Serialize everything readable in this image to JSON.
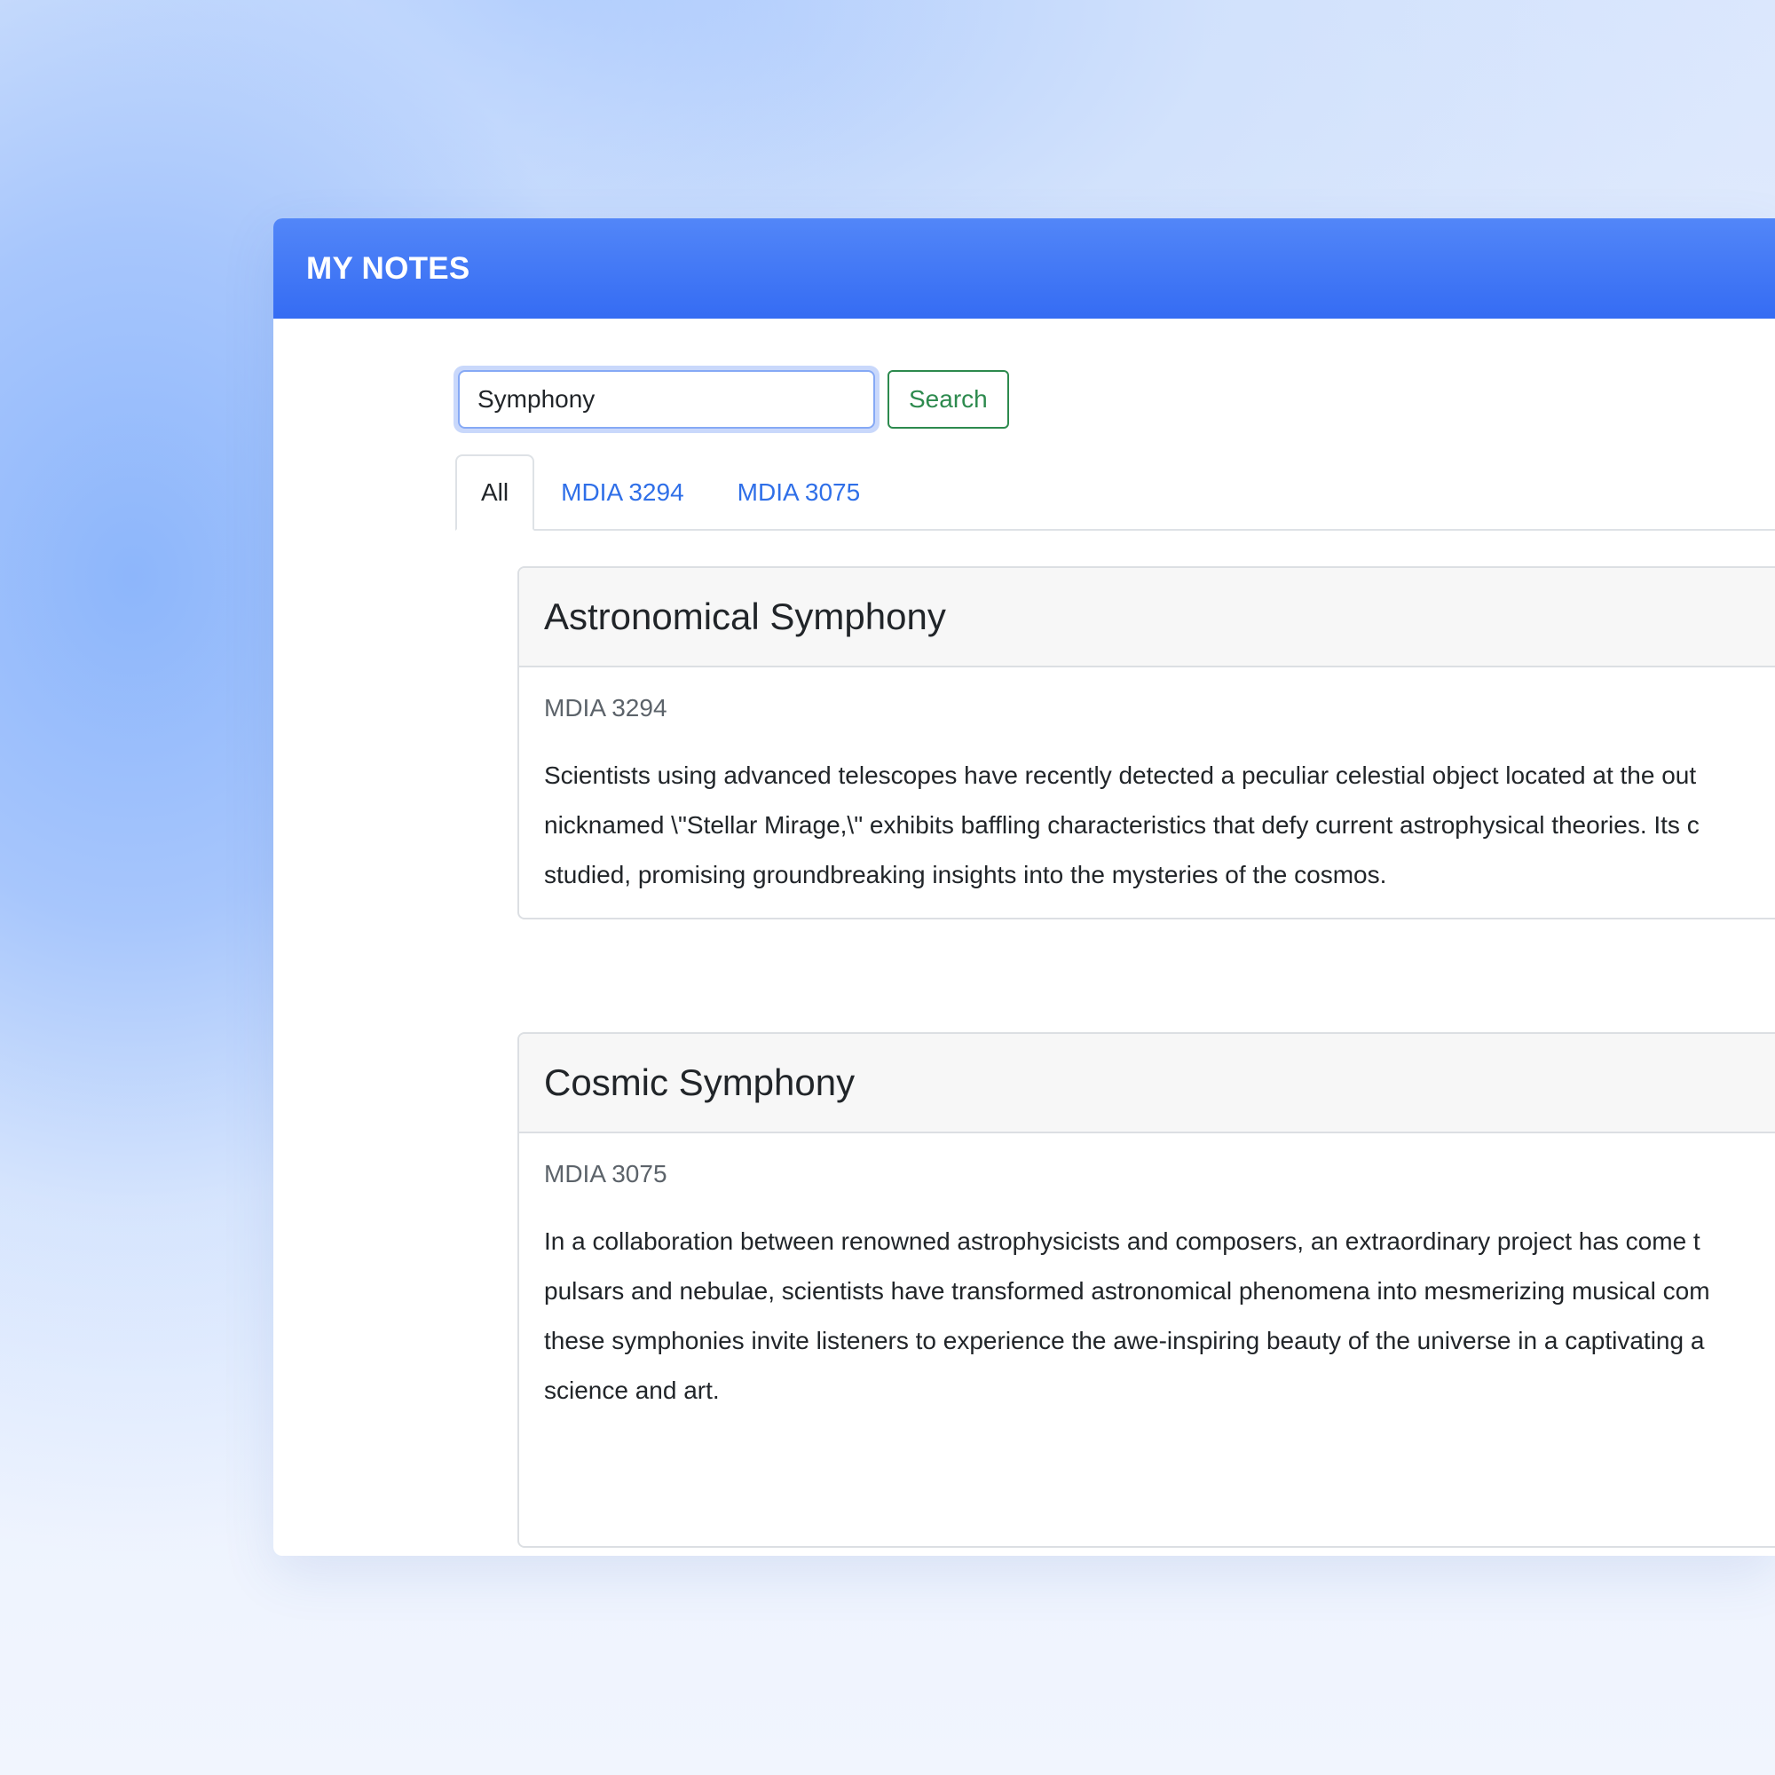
{
  "header": {
    "title": "MY NOTES"
  },
  "search": {
    "value": "Symphony",
    "button_label": "Search"
  },
  "tabs": [
    {
      "label": "All",
      "active": true
    },
    {
      "label": "MDIA 3294",
      "active": false
    },
    {
      "label": "MDIA 3075",
      "active": false
    }
  ],
  "notes": [
    {
      "title": "Astronomical Symphony",
      "course": "MDIA 3294",
      "lines": [
        "Scientists using advanced telescopes have recently detected a peculiar celestial object located at the out",
        "nicknamed \\\"Stellar Mirage,\\\" exhibits baffling characteristics that defy current astrophysical theories. Its c",
        "studied, promising groundbreaking insights into the mysteries of the cosmos."
      ]
    },
    {
      "title": "Cosmic Symphony",
      "course": "MDIA 3075",
      "lines": [
        "In a collaboration between renowned astrophysicists and composers, an extraordinary project has come t",
        "pulsars and nebulae, scientists have transformed astronomical phenomena into mesmerizing musical com",
        "these symphonies invite listeners to experience the awe-inspiring beauty of the universe in a captivating a",
        "science and art."
      ]
    }
  ],
  "colors": {
    "header_bg": "#3b72f4",
    "tab_link": "#2f6fe8",
    "search_button": "#2d8a4e"
  }
}
